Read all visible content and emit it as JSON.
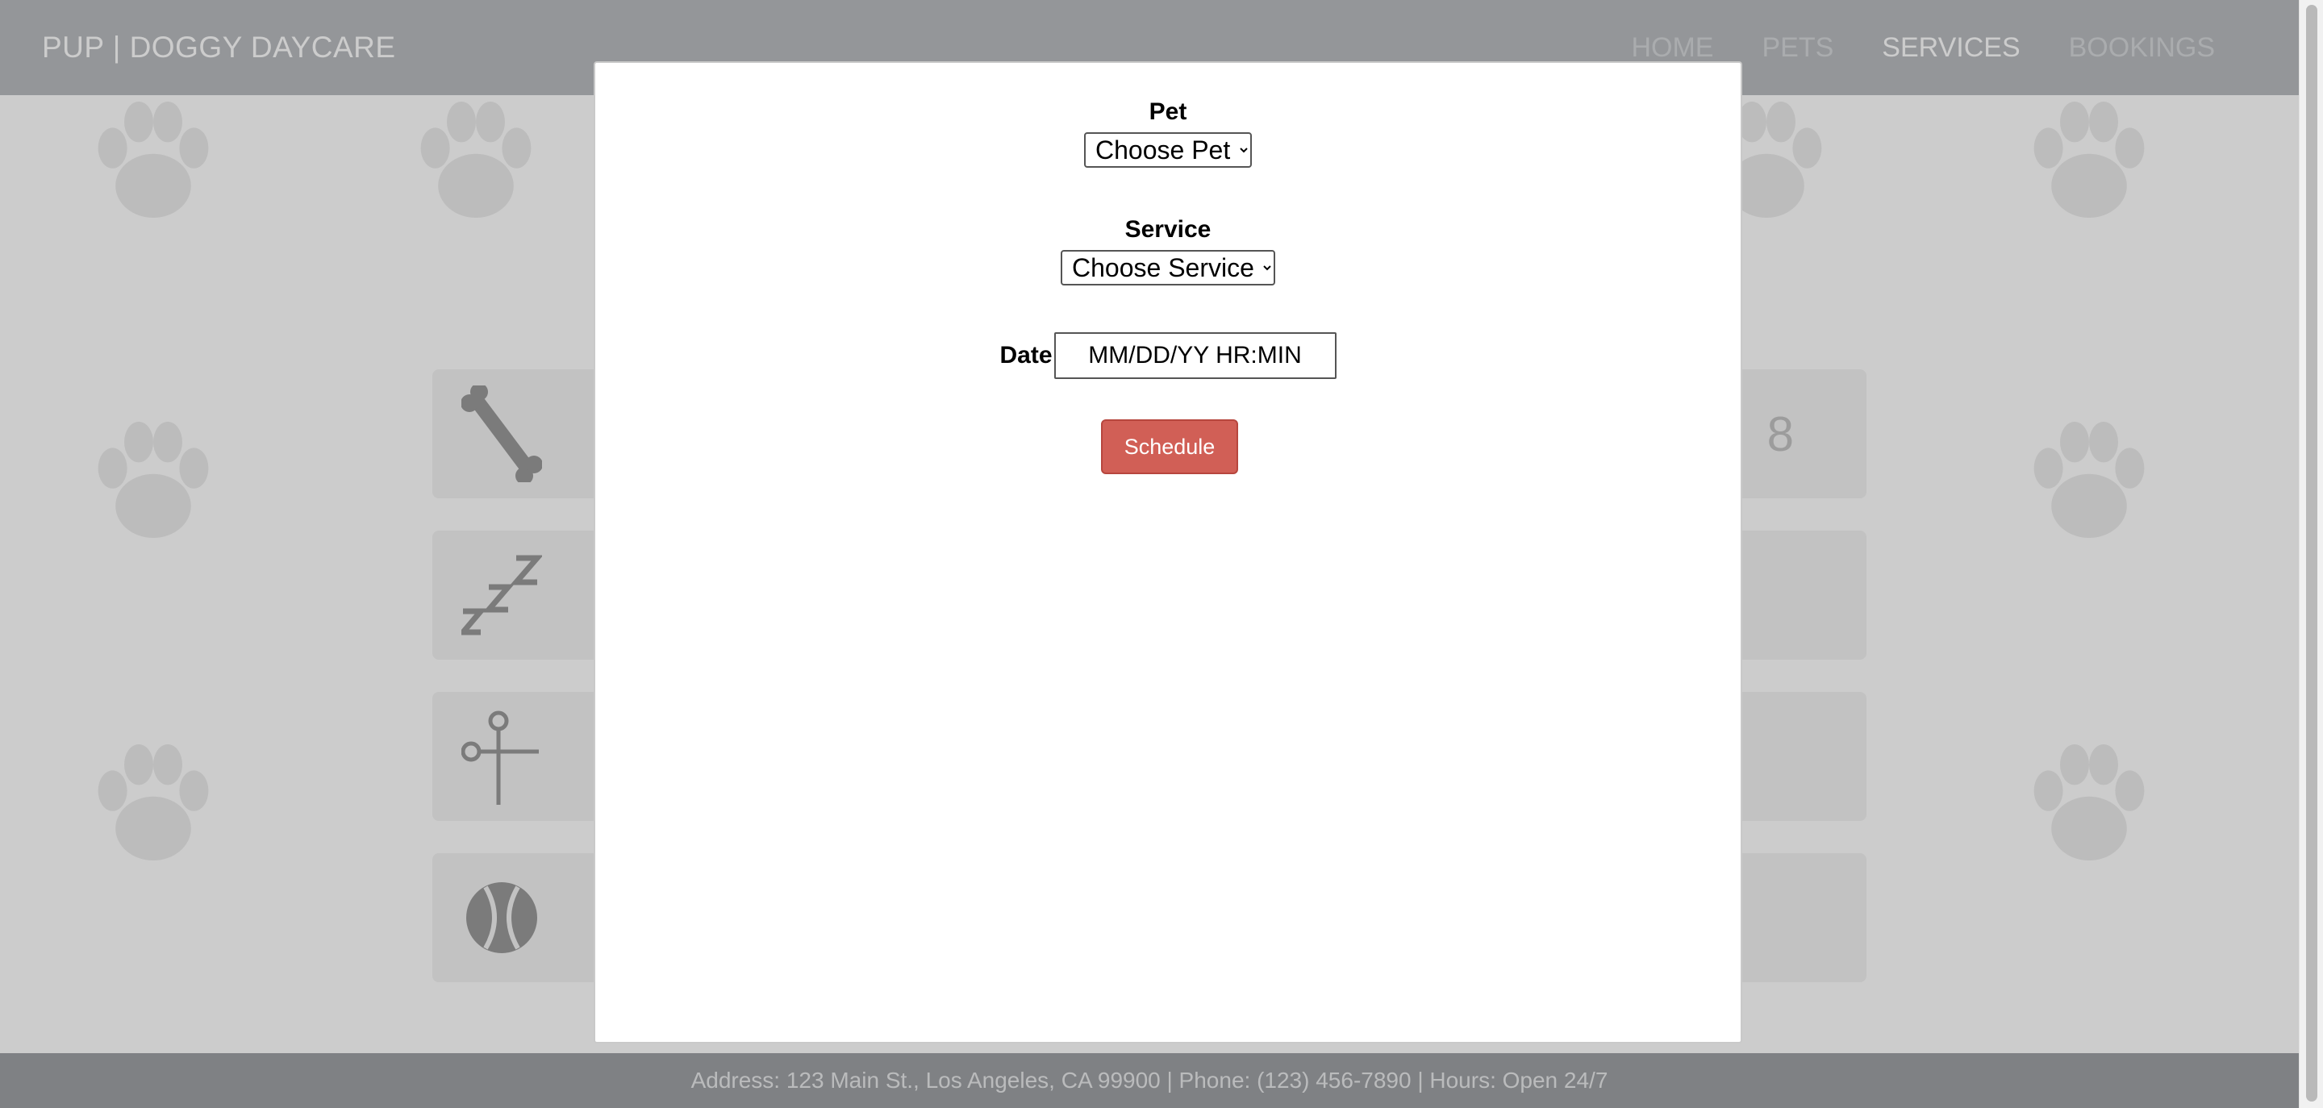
{
  "navbar": {
    "brand": "PUP | DOGGY DAYCARE",
    "links": [
      {
        "label": "HOME"
      },
      {
        "label": "PETS"
      },
      {
        "label": "SERVICES",
        "active": true
      },
      {
        "label": "BOOKINGS"
      }
    ]
  },
  "services": [
    {
      "icon": "bone-icon",
      "price_visible": "8"
    },
    {
      "icon": "sleep-zzz-icon"
    },
    {
      "icon": "scissors-icon"
    },
    {
      "icon": "tennis-ball-icon"
    }
  ],
  "modal": {
    "pet": {
      "label": "Pet",
      "selected": "Choose Pet"
    },
    "service": {
      "label": "Service",
      "selected": "Choose Service"
    },
    "date": {
      "label": "Date",
      "placeholder": "MM/DD/YY HR:MIN"
    },
    "schedule_label": "Schedule"
  },
  "footer": {
    "text": "Address: 123 Main St., Los Angeles, CA 99900 | Phone: (123) 456-7890 | Hours: Open 24/7"
  },
  "colors": {
    "accent_button": "#d15f56",
    "navbar": "#b9bcc0",
    "footer": "#9fa2a6"
  }
}
